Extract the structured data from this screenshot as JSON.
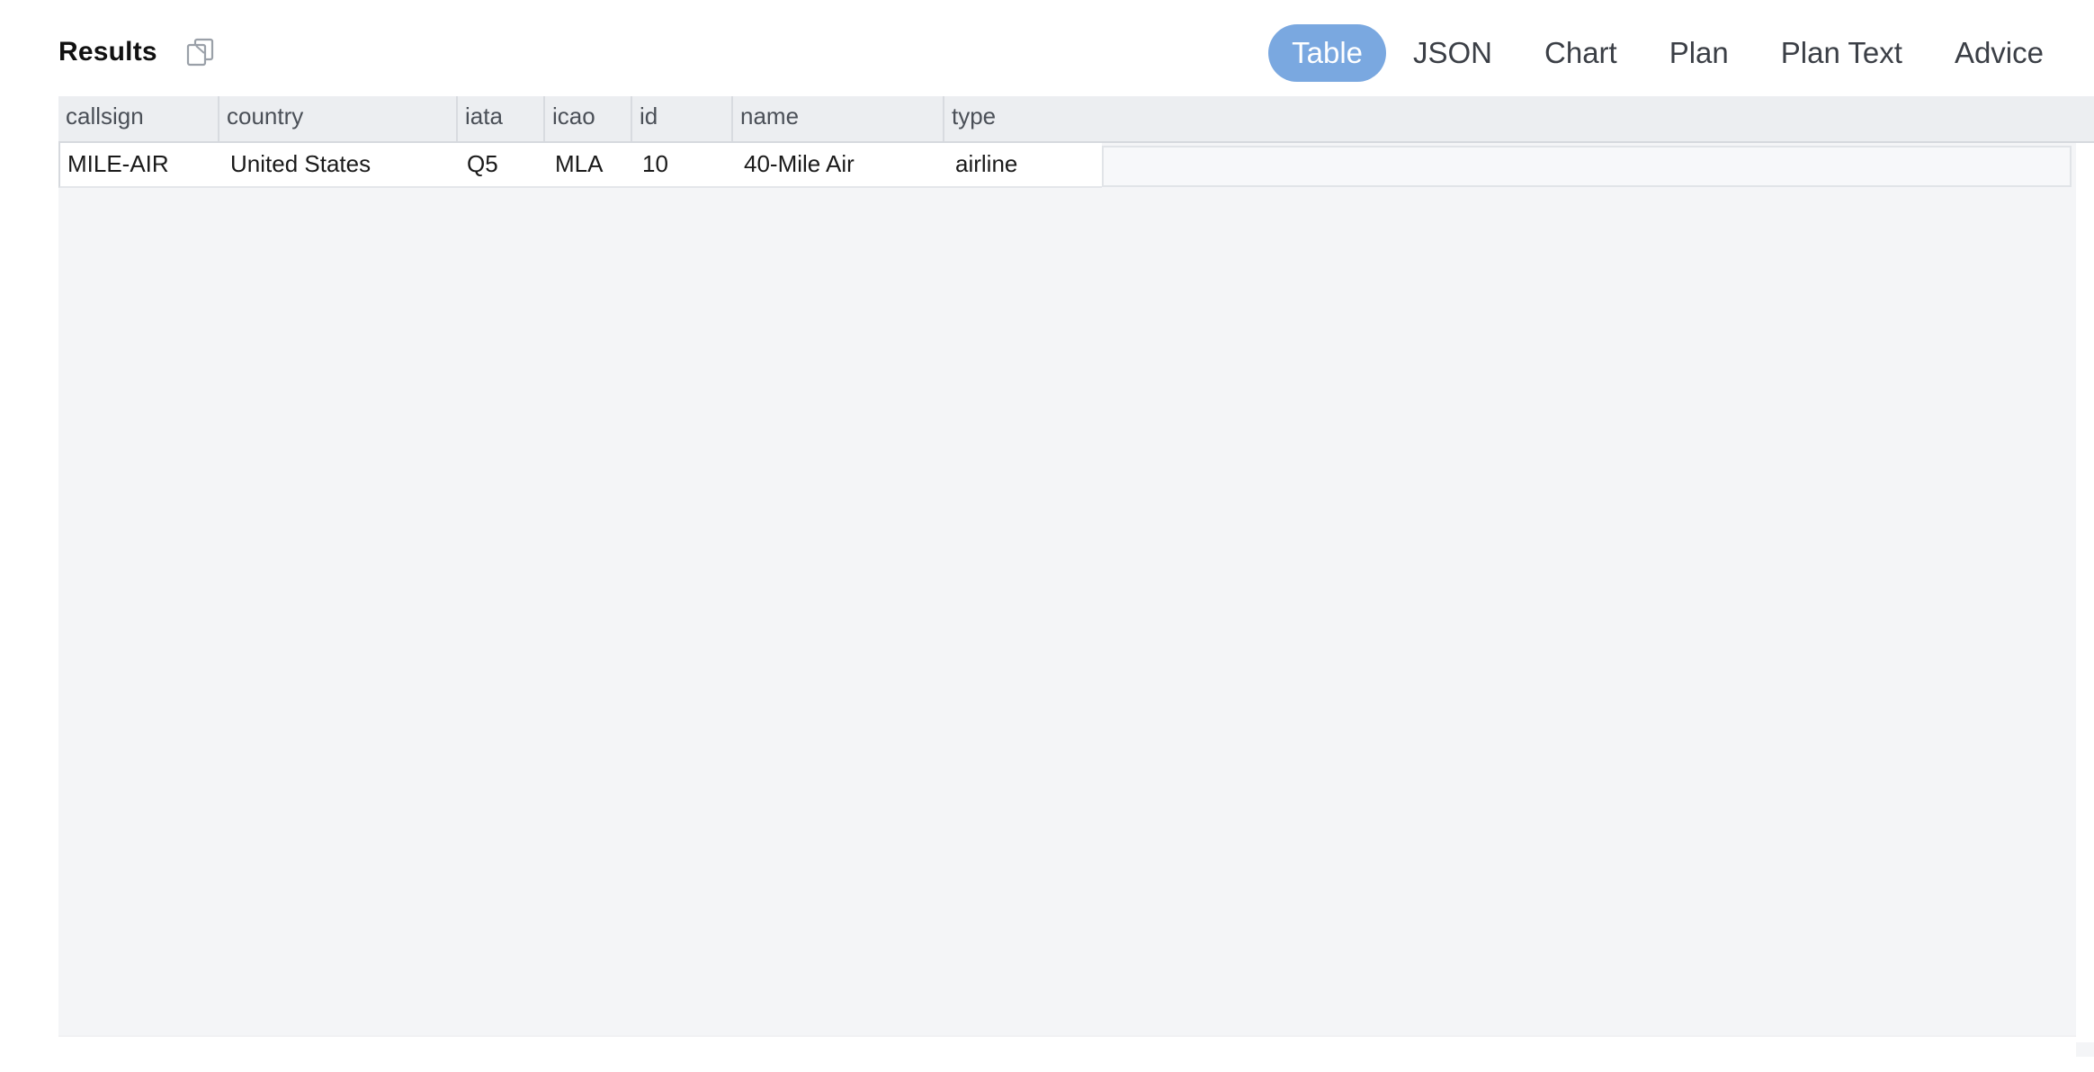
{
  "header": {
    "title": "Results",
    "copy_icon": "copy-icon"
  },
  "tabs": [
    {
      "label": "Table",
      "active": true
    },
    {
      "label": "JSON",
      "active": false
    },
    {
      "label": "Chart",
      "active": false
    },
    {
      "label": "Plan",
      "active": false
    },
    {
      "label": "Plan Text",
      "active": false
    },
    {
      "label": "Advice",
      "active": false
    }
  ],
  "table": {
    "columns": [
      "callsign",
      "country",
      "iata",
      "icao",
      "id",
      "name",
      "type"
    ],
    "rows": [
      [
        "MILE-AIR",
        "United States",
        "Q5",
        "MLA",
        "10",
        "40-Mile Air",
        "airline"
      ]
    ]
  },
  "colors": {
    "active_tab": "#7aa8e0",
    "grid_background": "#f4f5f7",
    "header_background": "#eceef1"
  }
}
